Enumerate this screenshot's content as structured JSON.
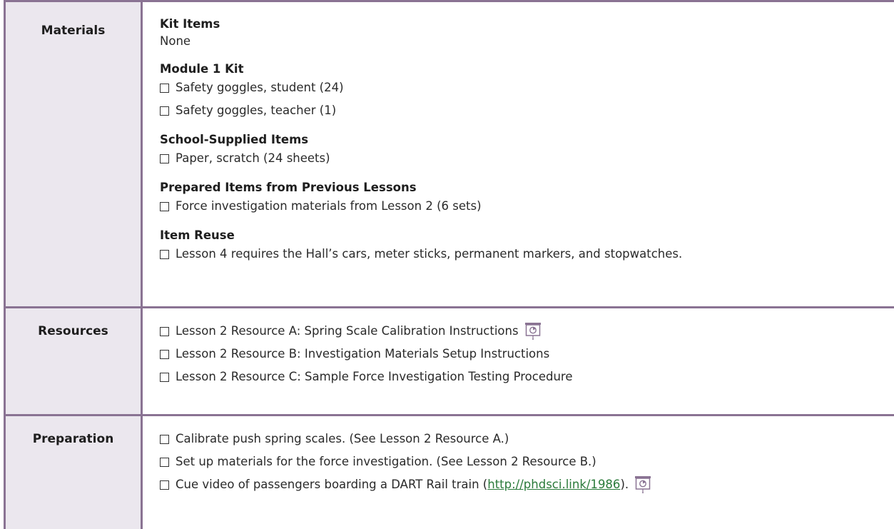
{
  "materials": {
    "label": "Materials",
    "sections": [
      {
        "title": "Kit Items",
        "plain": "None",
        "items": []
      },
      {
        "title": "Module 1 Kit",
        "items": [
          "Safety goggles, student (24)",
          "Safety goggles, teacher (1)"
        ]
      },
      {
        "title": "School-Supplied Items",
        "items": [
          "Paper, scratch (24 sheets)"
        ]
      },
      {
        "title": "Prepared Items from Previous Lessons",
        "items": [
          "Force investigation materials from Lesson 2 (6 sets)"
        ]
      },
      {
        "title": "Item Reuse",
        "items": [
          "Lesson 4 requires the Hall’s cars, meter sticks, permanent markers, and stopwatches."
        ]
      }
    ]
  },
  "resources": {
    "label": "Resources",
    "items": [
      "Lesson 2 Resource A: Spring Scale Calibration Instructions",
      "Lesson 2 Resource B: Investigation Materials Setup Instructions",
      "Lesson 2 Resource C: Sample Force Investigation Testing Procedure"
    ]
  },
  "preparation": {
    "label": "Preparation",
    "items": [
      "Calibrate push spring scales. (See Lesson 2 Resource A.)",
      "Set up materials for the force investigation. (See Lesson 2 Resource B.)"
    ],
    "video_prefix": "Cue video of passengers boarding a DART Rail train (",
    "video_link": "http://phdsci.link/1986",
    "video_suffix": ")."
  },
  "icons": {
    "projector": "projector-screen-icon"
  },
  "colors": {
    "border": "#8a7393",
    "label_bg": "#ebe7ee",
    "link": "#2a7a3a"
  }
}
